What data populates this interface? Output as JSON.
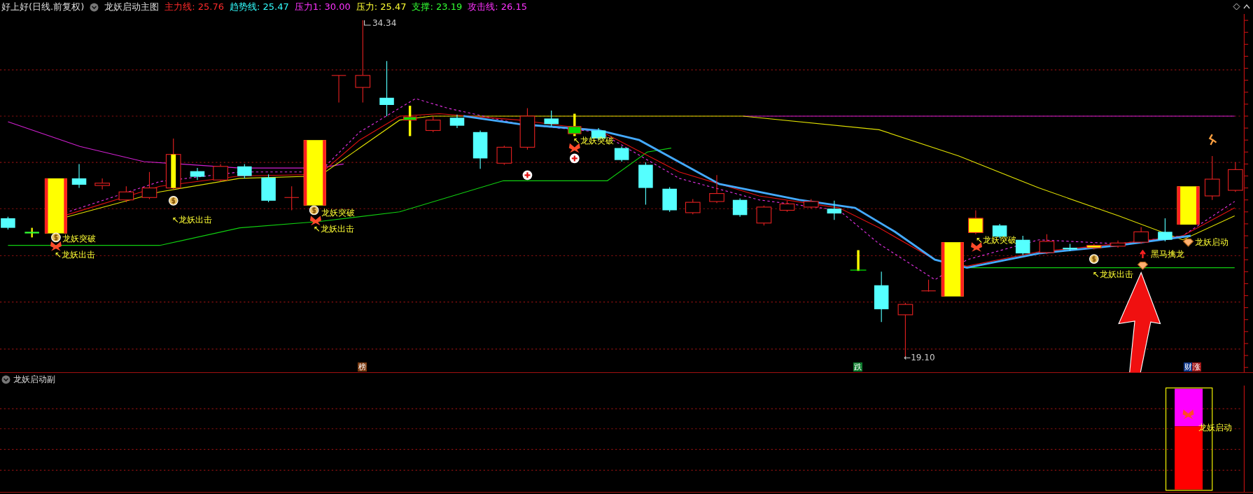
{
  "header": {
    "stock": "好上好(日线.前复权)",
    "indicator": "龙妖启动主图",
    "values": [
      {
        "label": "主力线: 25.76",
        "color": "#ff2a2a"
      },
      {
        "label": "趋势线: 25.47",
        "color": "#33ffff"
      },
      {
        "label": "压力1: 30.00",
        "color": "#ff33ff"
      },
      {
        "label": "压力: 25.47",
        "color": "#ffff33"
      },
      {
        "label": "支撑: 23.19",
        "color": "#33ff33"
      },
      {
        "label": "攻击线: 26.15",
        "color": "#ff33ff"
      }
    ]
  },
  "main_chart": {
    "high_label": "34.34",
    "low_label": "←19.10",
    "signals": [
      {
        "text": "龙妖突破"
      },
      {
        "text": "↖龙妖出击"
      },
      {
        "text": "↖龙妖出击"
      },
      {
        "text": "龙妖突破"
      },
      {
        "text": "↖龙妖出击"
      },
      {
        "text": "↖龙妖突破"
      },
      {
        "text": "↖龙妖突破"
      },
      {
        "text": "黑马擒龙"
      },
      {
        "text": "↖龙妖出击"
      },
      {
        "text": "龙妖启动"
      }
    ],
    "markers": [
      {
        "text": "榜",
        "color": "#7a3a10"
      },
      {
        "text": "跌",
        "color": "#0c7a2c"
      },
      {
        "text": "财",
        "color": "#123a8a"
      },
      {
        "text": "涨",
        "color": "#a01818"
      }
    ]
  },
  "sub_panel": {
    "title": "龙妖启动副",
    "signal": "龙妖启动"
  }
}
